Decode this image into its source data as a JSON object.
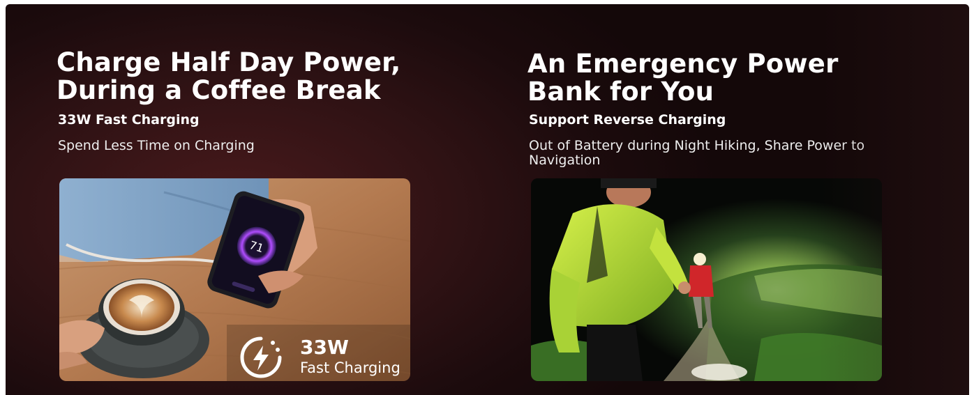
{
  "left_panel": {
    "headline": "Charge Half Day Power,\nDuring a Coffee Break",
    "subheadline": "33W Fast Charging",
    "description": "Spend Less Time on Charging",
    "badge": {
      "watt": "33W",
      "caption": "Fast Charging",
      "icon": "fast-charge-bolt-icon"
    },
    "phone_screen_text": "71"
  },
  "right_panel": {
    "headline": "An Emergency Power\nBank for You",
    "subheadline": "Support Reverse Charging",
    "description": "Out of Battery during Night Hiking, Share Power to Navigation"
  },
  "colors": {
    "background": "#1c0b0d",
    "text": "#ffffff",
    "jacket": "#b6e23a",
    "hiker_red": "#d0262a",
    "charge_ring": "#9b3dff"
  }
}
